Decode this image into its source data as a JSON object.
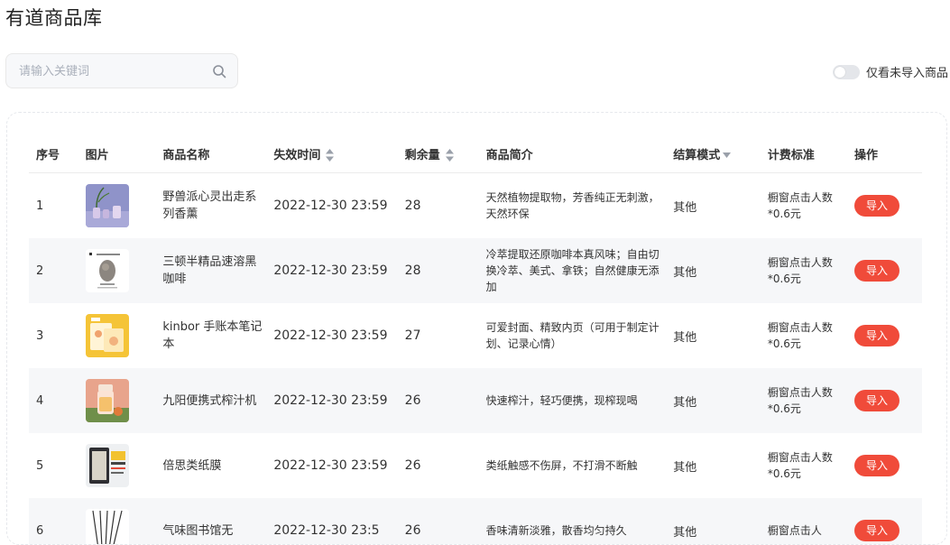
{
  "page": {
    "title": "有道商品库"
  },
  "search": {
    "placeholder": "请输入关键词"
  },
  "filter": {
    "toggle_label": "仅看未导入商品",
    "toggle_on": false
  },
  "table": {
    "headers": {
      "seq": "序号",
      "image": "图片",
      "name": "商品名称",
      "expire": "失效时间",
      "stock": "剩余量",
      "desc": "商品简介",
      "settle": "结算模式",
      "fee": "计费标准",
      "op": "操作"
    },
    "rows": [
      {
        "seq": "1",
        "image": "perfume-set-thumbnail",
        "name": "野兽派心灵出走系列香薰",
        "expire": "2022-12-30 23:59",
        "stock": "28",
        "desc": "天然植物提取物，芳香纯正无刺激，天然环保",
        "settle": "其他",
        "fee": "橱窗点击人数*0.6元",
        "op": "导入"
      },
      {
        "seq": "2",
        "image": "coffee-package-thumbnail",
        "name": "三顿半精品速溶黑咖啡",
        "expire": "2022-12-30 23:59",
        "stock": "28",
        "desc": "冷萃提取还原咖啡本真风味；自由切换冷萃、美式、拿铁；自然健康无添加",
        "settle": "其他",
        "fee": "橱窗点击人数*0.6元",
        "op": "导入"
      },
      {
        "seq": "3",
        "image": "notebook-thumbnail",
        "name": "kinbor 手账本笔记本",
        "expire": "2022-12-30 23:59",
        "stock": "27",
        "desc": "可爱封面、精致内页（可用于制定计划、记录心情）",
        "settle": "其他",
        "fee": "橱窗点击人数*0.6元",
        "op": "导入"
      },
      {
        "seq": "4",
        "image": "juicer-thumbnail",
        "name": "九阳便携式榨汁机",
        "expire": "2022-12-30 23:59",
        "stock": "26",
        "desc": "快速榨汁，轻巧便携，现榨现喝",
        "settle": "其他",
        "fee": "橱窗点击人数*0.6元",
        "op": "导入"
      },
      {
        "seq": "5",
        "image": "screen-film-thumbnail",
        "name": "倍思类纸膜",
        "expire": "2022-12-30 23:59",
        "stock": "26",
        "desc": "类纸触感不伤屏，不打滑不断触",
        "settle": "其他",
        "fee": "橱窗点击人数*0.6元",
        "op": "导入"
      },
      {
        "seq": "6",
        "image": "reed-diffuser-thumbnail",
        "name": "气味图书馆无",
        "expire": "2022-12-30 23:5",
        "stock": "26",
        "desc": "香味清新淡雅，散香均匀持久",
        "settle": "其他",
        "fee": "橱窗点击人",
        "op": "导入"
      }
    ]
  },
  "colors": {
    "accent": "#f04b3a",
    "stripe": "#f6f7f9",
    "border": "#e6e8ec"
  }
}
